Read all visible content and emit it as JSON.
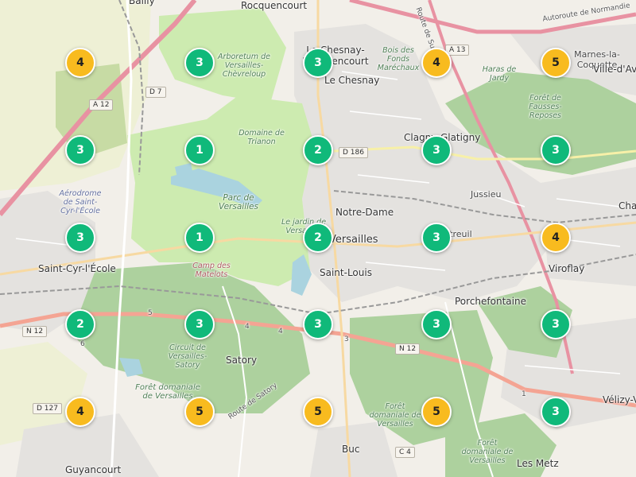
{
  "map": {
    "places": [
      {
        "name": "Bailly"
      },
      {
        "name": "Rocquencourt"
      },
      {
        "name": "Le Chesnay-Rocquencourt"
      },
      {
        "name": "Le Chesnay"
      },
      {
        "name": "Marnes-la-Coquette"
      },
      {
        "name": "Ville-d'Avray"
      },
      {
        "name": "Clagny-Glatigny"
      },
      {
        "name": "Jussieu"
      },
      {
        "name": "Notre-Dame"
      },
      {
        "name": "Versailles"
      },
      {
        "name": "Saint-Louis"
      },
      {
        "name": "Montreuil"
      },
      {
        "name": "Viroflay"
      },
      {
        "name": "Chaville"
      },
      {
        "name": "Porchefontaine"
      },
      {
        "name": "Saint-Cyr-l'École"
      },
      {
        "name": "Satory"
      },
      {
        "name": "Buc"
      },
      {
        "name": "Guyancourt"
      },
      {
        "name": "Les Metz"
      },
      {
        "name": "Vélizy-Villacoublay"
      }
    ],
    "parks": [
      {
        "name": "Arboretum de Versailles-Chèvreloup"
      },
      {
        "name": "Bois des Fonds Maréchaux"
      },
      {
        "name": "Haras de Jardy"
      },
      {
        "name": "Forêt de Fausses-Reposes"
      },
      {
        "name": "Domaine de Trianon"
      },
      {
        "name": "Parc de Versailles"
      },
      {
        "name": "Le jardin de Versailles"
      },
      {
        "name": "Aérodrome de Saint-Cyr-l'École"
      },
      {
        "name": "Circuit de Versailles-Satory"
      },
      {
        "name": "Forêt domaniale de Versailles"
      },
      {
        "name": "Forêt domaniale de Versailles"
      },
      {
        "name": "Forêt domaniale de Versailles"
      }
    ],
    "pois": [
      {
        "name": "Camp des Matelots"
      }
    ],
    "road_refs": [
      "A 12",
      "D 7",
      "D 186",
      "N 12",
      "D 127",
      "C 4",
      "A 13",
      "5",
      "4",
      "4",
      "3",
      "6",
      "1"
    ],
    "road_names": [
      "Autoroute de Normandie",
      "Route de Satory",
      "Route de Sully"
    ],
    "colors": {
      "cluster_green": "#10b97a",
      "cluster_yellow": "#f8bb1f",
      "forest": "#add19e",
      "park": "#c8facc",
      "water": "#aad3df",
      "urban": "#e0dfdf",
      "motorway": "#e892a2",
      "trunk": "#f9b29c"
    },
    "clusters": [
      {
        "count": "4",
        "color": "yellow"
      },
      {
        "count": "3",
        "color": "green"
      },
      {
        "count": "3",
        "color": "green"
      },
      {
        "count": "4",
        "color": "yellow"
      },
      {
        "count": "5",
        "color": "yellow"
      },
      {
        "count": "3",
        "color": "green"
      },
      {
        "count": "1",
        "color": "green"
      },
      {
        "count": "2",
        "color": "green"
      },
      {
        "count": "3",
        "color": "green"
      },
      {
        "count": "3",
        "color": "green"
      },
      {
        "count": "3",
        "color": "green"
      },
      {
        "count": "1",
        "color": "green"
      },
      {
        "count": "2",
        "color": "green"
      },
      {
        "count": "3",
        "color": "green"
      },
      {
        "count": "4",
        "color": "yellow"
      },
      {
        "count": "2",
        "color": "green"
      },
      {
        "count": "3",
        "color": "green"
      },
      {
        "count": "3",
        "color": "green"
      },
      {
        "count": "3",
        "color": "green"
      },
      {
        "count": "3",
        "color": "green"
      },
      {
        "count": "4",
        "color": "yellow"
      },
      {
        "count": "5",
        "color": "yellow"
      },
      {
        "count": "5",
        "color": "yellow"
      },
      {
        "count": "5",
        "color": "yellow"
      },
      {
        "count": "3",
        "color": "green"
      }
    ]
  }
}
